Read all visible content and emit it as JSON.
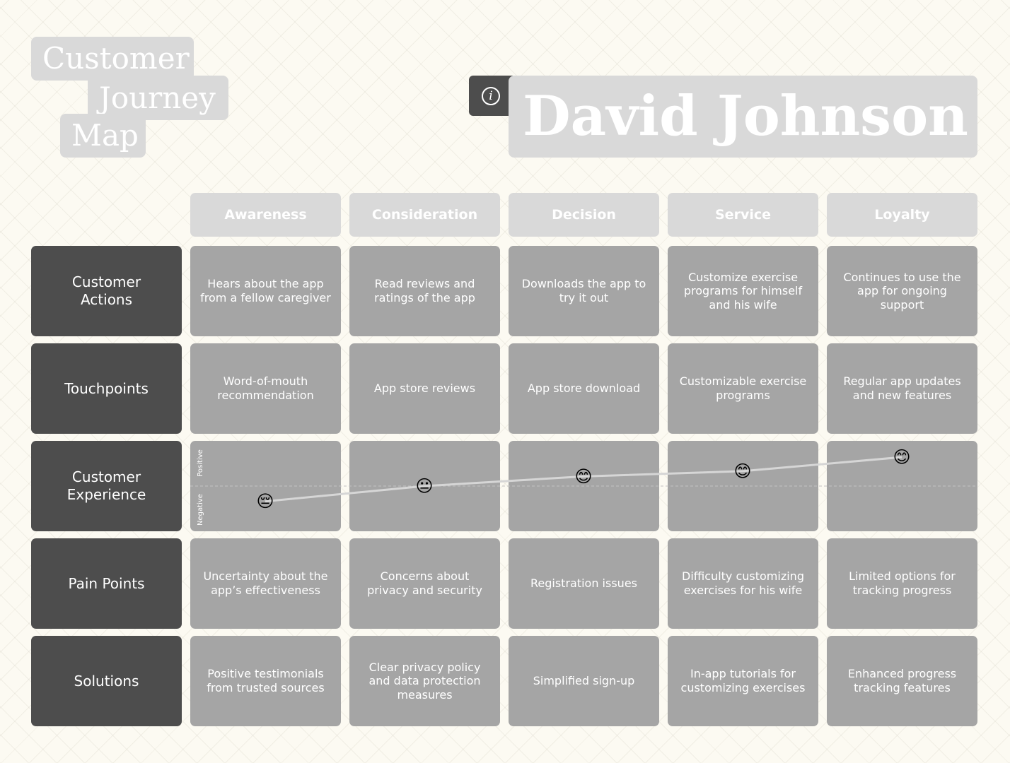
{
  "title": {
    "line1": "Customer",
    "line2": "Journey",
    "line3": "Map"
  },
  "persona": {
    "name": "David Johnson",
    "info_icon": "info-icon"
  },
  "stages": [
    "Awareness",
    "Consideration",
    "Decision",
    "Service",
    "Loyalty"
  ],
  "rows": [
    {
      "label": "Customer Actions",
      "cells": [
        "Hears about the app from a fellow caregiver",
        "Read reviews and ratings of the app",
        "Downloads the app to try it out",
        "Customize exercise programs for himself and his wife",
        "Continues to use the app for ongoing support"
      ]
    },
    {
      "label": "Touchpoints",
      "cells": [
        "Word-of-mouth recommendation",
        "App store reviews",
        "App store download",
        "Customizable exercise programs",
        "Regular app updates and new features"
      ]
    },
    {
      "label": "Customer Experience",
      "cells": [
        "",
        "",
        "",
        "",
        ""
      ]
    },
    {
      "label": "Pain Points",
      "cells": [
        "Uncertainty about the app’s effectiveness",
        "Concerns about privacy and security",
        "Registration issues",
        "Difficulty customizing exercises for his wife",
        "Limited options for tracking progress"
      ]
    },
    {
      "label": "Solutions",
      "cells": [
        "Positive testimonials from trusted sources",
        "Clear privacy policy and data protection measures",
        "Simplified sign-up",
        "In-app tutorials for customizing exercises",
        "Enhanced progress tracking features"
      ]
    }
  ],
  "chart_data": {
    "type": "line",
    "categories": [
      "Awareness",
      "Consideration",
      "Decision",
      "Service",
      "Loyalty"
    ],
    "values": [
      -0.35,
      0.0,
      0.22,
      0.34,
      0.66
    ],
    "ylim": [
      -1,
      1
    ],
    "ylabel_top": "Positive",
    "ylabel_bottom": "Negative",
    "emotions": [
      "😔",
      "😐",
      "😊",
      "😊",
      "😊"
    ],
    "line_color": "#d6d6d6",
    "grid": false
  },
  "colors": {
    "background": "#fcfaf2",
    "chip": "#d9d9d9",
    "dark": "#4d4d4d",
    "cell": "#a5a5a5",
    "text": "#ffffff"
  }
}
